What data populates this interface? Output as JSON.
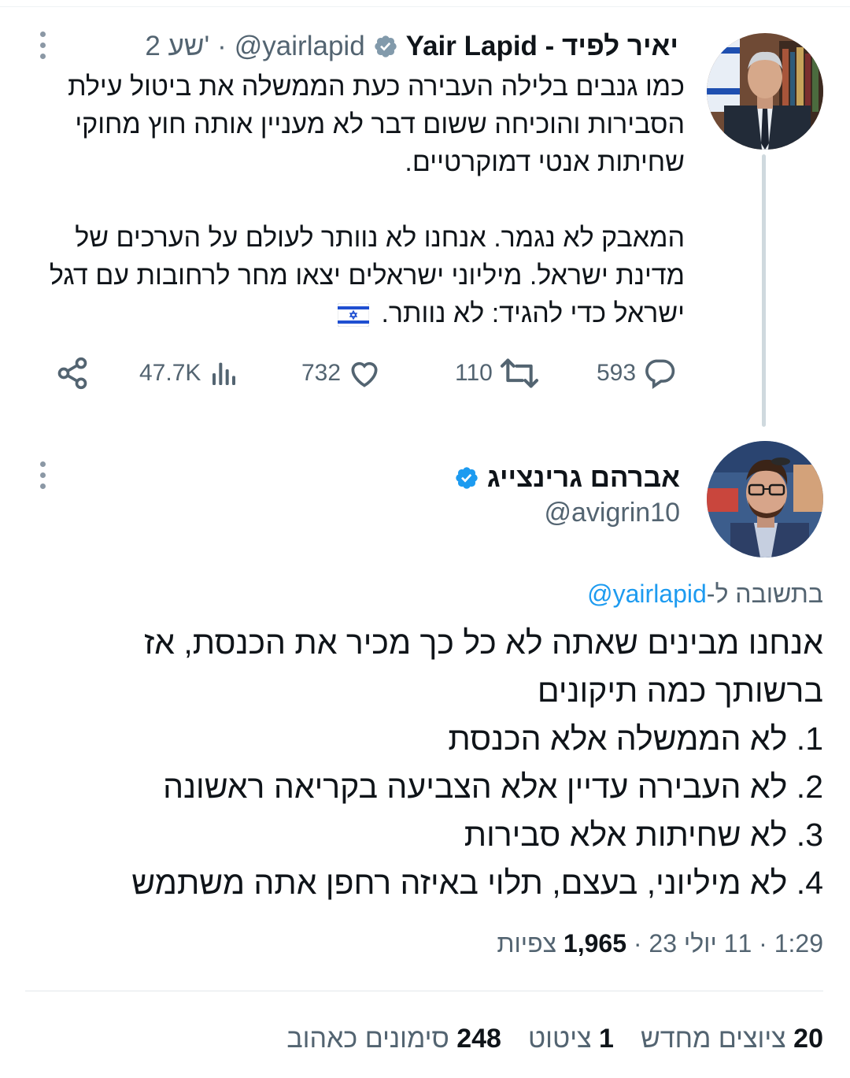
{
  "colors": {
    "accent": "#1d9bf0",
    "text": "#0f1419",
    "secondary": "#536471",
    "thread_line": "#cfd9de"
  },
  "original_tweet": {
    "display_name": "Yair Lapid - יאיר לפיד",
    "handle": "@yairlapid",
    "separator": "·",
    "time_ago": "2 שע'",
    "paragraph1": "כמו גנבים בלילה העבירה כעת הממשלה את ביטול עילת הסבירות והוכיחה ששום דבר לא מעניין אותה חוץ מחוקי שחיתות אנטי דמוקרטיים.",
    "paragraph2": "המאבק לא נגמר. אנחנו לא נוותר לעולם על הערכים של מדינת ישראל. מיליוני ישראלים יצאו מחר לרחובות עם דגל ישראל כדי להגיד: לא נוותר.",
    "verified_icon": "verified-badge-icon",
    "flag_icon": "israel-flag-icon",
    "actions": {
      "reply_count": "593",
      "retweet_count": "110",
      "like_count": "732",
      "views_count": "47.7K"
    }
  },
  "reply_tweet": {
    "display_name": "אברהם גרינצייג",
    "handle": "@avigrin10",
    "replying_prefix": "בתשובה ל-",
    "replying_to": "@yairlapid",
    "line1": "אנחנו מבינים שאתה לא כל כך מכיר את הכנסת, אז ברשותך כמה תיקונים",
    "item1": "1. לא הממשלה אלא הכנסת",
    "item2": "2. לא העבירה עדיין אלא הצביעה בקריאה ראשונה",
    "item3": "3. לא שחיתות אלא סבירות",
    "item4": "4. לא מיליוני, בעצם, תלוי באיזה רחפן אתה משתמש",
    "time": "1:29",
    "date": "11 יולי 23",
    "views_count": "1,965",
    "views_label": "צפיות",
    "stats": {
      "retweets_count": "20",
      "retweets_label": "ציוצים מחדש",
      "quotes_count": "1",
      "quotes_label": "ציטוט",
      "likes_count": "248",
      "likes_label": "סימונים כאהוב"
    }
  }
}
